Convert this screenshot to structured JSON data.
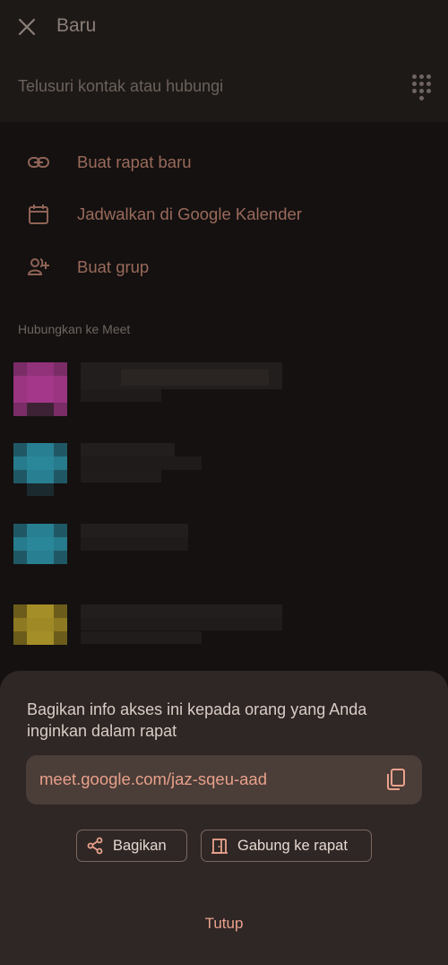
{
  "header": {
    "title": "Baru",
    "search_placeholder": "Telusuri kontak atau hubungi"
  },
  "actions": [
    {
      "label": "Buat rapat baru",
      "icon": "link-icon"
    },
    {
      "label": "Jadwalkan di Google Kalender",
      "icon": "calendar-icon"
    },
    {
      "label": "Buat grup",
      "icon": "add-group-icon"
    }
  ],
  "contacts_section": {
    "title": "Hubungkan ke Meet"
  },
  "contacts": [
    {
      "avatar_color": "#b03a93"
    },
    {
      "avatar_color": "#2a8a9c"
    },
    {
      "avatar_color": "#2a8a9c"
    },
    {
      "avatar_color": "#b39b2a"
    }
  ],
  "sheet": {
    "info_text": "Bagikan info akses ini kepada orang yang Anda inginkan dalam rapat",
    "meeting_link": "meet.google.com/jaz-sqeu-aad",
    "share_label": "Bagikan",
    "join_label": "Gabung ke rapat",
    "close_label": "Tutup"
  },
  "colors": {
    "accent": "#e9a28c",
    "sheet_bg": "#2f2725",
    "link_box_bg": "#4b3d38"
  }
}
